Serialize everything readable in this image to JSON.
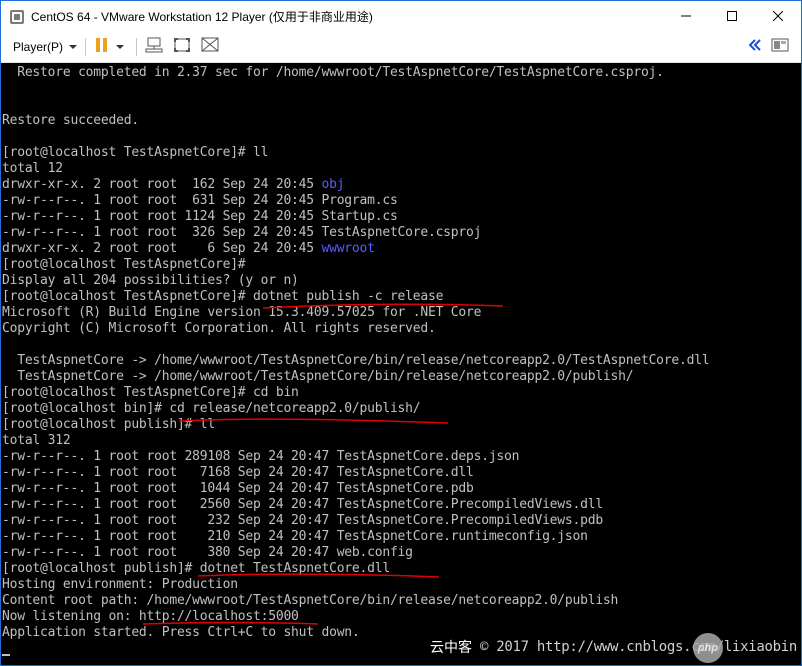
{
  "window": {
    "title": "CentOS 64 - VMware Workstation 12 Player (仅用于非商业用途)"
  },
  "toolbar": {
    "player_menu_label": "Player(P)"
  },
  "console": {
    "lines": [
      [
        {
          "t": "  Restore completed in 2.37 sec for /home/wwwroot/TestAspnetCore/TestAspnetCore.csproj."
        }
      ],
      [
        {
          "t": ""
        }
      ],
      [
        {
          "t": ""
        }
      ],
      [
        {
          "t": "Restore succeeded."
        }
      ],
      [
        {
          "t": ""
        }
      ],
      [
        {
          "t": "[root@localhost TestAspnetCore]# ll"
        }
      ],
      [
        {
          "t": "total 12"
        }
      ],
      [
        {
          "t": "drwxr-xr-x. 2 root root  162 Sep 24 20:45 "
        },
        {
          "t": "obj",
          "c": "dir"
        }
      ],
      [
        {
          "t": "-rw-r--r--. 1 root root  631 Sep 24 20:45 Program.cs"
        }
      ],
      [
        {
          "t": "-rw-r--r--. 1 root root 1124 Sep 24 20:45 Startup.cs"
        }
      ],
      [
        {
          "t": "-rw-r--r--. 1 root root  326 Sep 24 20:45 TestAspnetCore.csproj"
        }
      ],
      [
        {
          "t": "drwxr-xr-x. 2 root root    6 Sep 24 20:45 "
        },
        {
          "t": "wwwroot",
          "c": "dir"
        }
      ],
      [
        {
          "t": "[root@localhost TestAspnetCore]#"
        }
      ],
      [
        {
          "t": "Display all 204 possibilities? (y or n)"
        }
      ],
      [
        {
          "t": "[root@localhost TestAspnetCore]# dotnet publish -c release"
        }
      ],
      [
        {
          "t": "Microsoft (R) Build Engine version 15.3.409.57025 for .NET Core"
        }
      ],
      [
        {
          "t": "Copyright (C) Microsoft Corporation. All rights reserved."
        }
      ],
      [
        {
          "t": ""
        }
      ],
      [
        {
          "t": "  TestAspnetCore -> /home/wwwroot/TestAspnetCore/bin/release/netcoreapp2.0/TestAspnetCore.dll"
        }
      ],
      [
        {
          "t": "  TestAspnetCore -> /home/wwwroot/TestAspnetCore/bin/release/netcoreapp2.0/publish/"
        }
      ],
      [
        {
          "t": "[root@localhost TestAspnetCore]# cd bin"
        }
      ],
      [
        {
          "t": "[root@localhost bin]# cd release/netcoreapp2.0/publish/"
        }
      ],
      [
        {
          "t": "[root@localhost publish]# ll"
        }
      ],
      [
        {
          "t": "total 312"
        }
      ],
      [
        {
          "t": "-rw-r--r--. 1 root root 289108 Sep 24 20:47 TestAspnetCore.deps.json"
        }
      ],
      [
        {
          "t": "-rw-r--r--. 1 root root   7168 Sep 24 20:47 TestAspnetCore.dll"
        }
      ],
      [
        {
          "t": "-rw-r--r--. 1 root root   1044 Sep 24 20:47 TestAspnetCore.pdb"
        }
      ],
      [
        {
          "t": "-rw-r--r--. 1 root root   2560 Sep 24 20:47 TestAspnetCore.PrecompiledViews.dll"
        }
      ],
      [
        {
          "t": "-rw-r--r--. 1 root root    232 Sep 24 20:47 TestAspnetCore.PrecompiledViews.pdb"
        }
      ],
      [
        {
          "t": "-rw-r--r--. 1 root root    210 Sep 24 20:47 TestAspnetCore.runtimeconfig.json"
        }
      ],
      [
        {
          "t": "-rw-r--r--. 1 root root    380 Sep 24 20:47 web.config"
        }
      ],
      [
        {
          "t": "[root@localhost publish]# dotnet TestAspnetCore.dll"
        }
      ],
      [
        {
          "t": "Hosting environment: Production"
        }
      ],
      [
        {
          "t": "Content root path: /home/wwwroot/TestAspnetCore/bin/release/netcoreapp2.0/publish"
        }
      ],
      [
        {
          "t": "Now listening on: http://localhost:5000"
        }
      ],
      [
        {
          "t": "Application started. Press Ctrl+C to shut down."
        }
      ]
    ]
  },
  "watermark": {
    "site": "云中客",
    "text": "© 2017 http://www.cnblogs.com/lixiaobin",
    "badge": "php"
  },
  "colors": {
    "console_bg": "#000000",
    "console_fg": "#c0c0c0",
    "directory": "#5a5aff",
    "annotation": "#e00000"
  },
  "icons": [
    "vmware-app-icon",
    "minimize-icon",
    "maximize-icon",
    "close-icon",
    "pause-icon",
    "send-ctrl-alt-del-icon",
    "fullscreen-icon",
    "unity-icon",
    "collapse-left-icon",
    "vm-status-icon"
  ]
}
